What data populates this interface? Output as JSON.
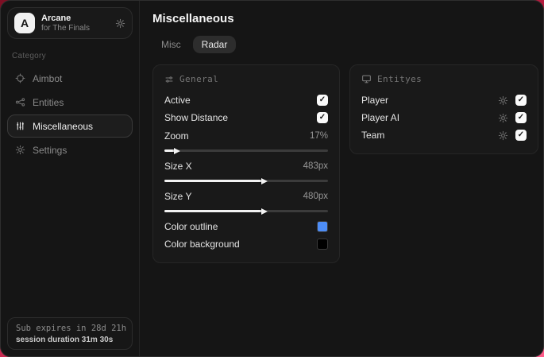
{
  "app": {
    "name": "Arcane",
    "subtitle": "for The Finals",
    "avatar_letter": "A"
  },
  "sidebar": {
    "category_label": "Category",
    "items": [
      {
        "label": "Aimbot",
        "icon": "crosshair-icon",
        "active": false
      },
      {
        "label": "Entities",
        "icon": "entities-icon",
        "active": false
      },
      {
        "label": "Miscellaneous",
        "icon": "equalizer-icon",
        "active": true
      },
      {
        "label": "Settings",
        "icon": "gear-icon",
        "active": false
      }
    ],
    "subscription": {
      "expires_text": "Sub expires in 28d 21h",
      "session_text": "session duration 31m 30s"
    }
  },
  "main": {
    "title": "Miscellaneous",
    "tabs": [
      {
        "label": "Misc",
        "active": false
      },
      {
        "label": "Radar",
        "active": true
      }
    ]
  },
  "general_panel": {
    "title": "General",
    "icon": "sliders-icon",
    "toggles": [
      {
        "label": "Active",
        "checked": true
      },
      {
        "label": "Show Distance",
        "checked": true
      }
    ],
    "sliders": [
      {
        "label": "Zoom",
        "value": "17%",
        "percent": 7
      },
      {
        "label": "Size X",
        "value": "483px",
        "percent": 60
      },
      {
        "label": "Size Y",
        "value": "480px",
        "percent": 60
      }
    ],
    "colors": [
      {
        "label": "Color outline",
        "swatch": "#4d8df6"
      },
      {
        "label": "Color background",
        "swatch": "#000000"
      }
    ]
  },
  "entities_panel": {
    "title": "Entityes",
    "icon": "monitor-icon",
    "rows": [
      {
        "label": "Player",
        "checked": true
      },
      {
        "label": "Player AI",
        "checked": true
      },
      {
        "label": "Team",
        "checked": true
      }
    ]
  },
  "colors": {
    "accent_blue": "#4d8df6",
    "backdrop_red": "#b81b3f",
    "window_bg": "#151515"
  }
}
